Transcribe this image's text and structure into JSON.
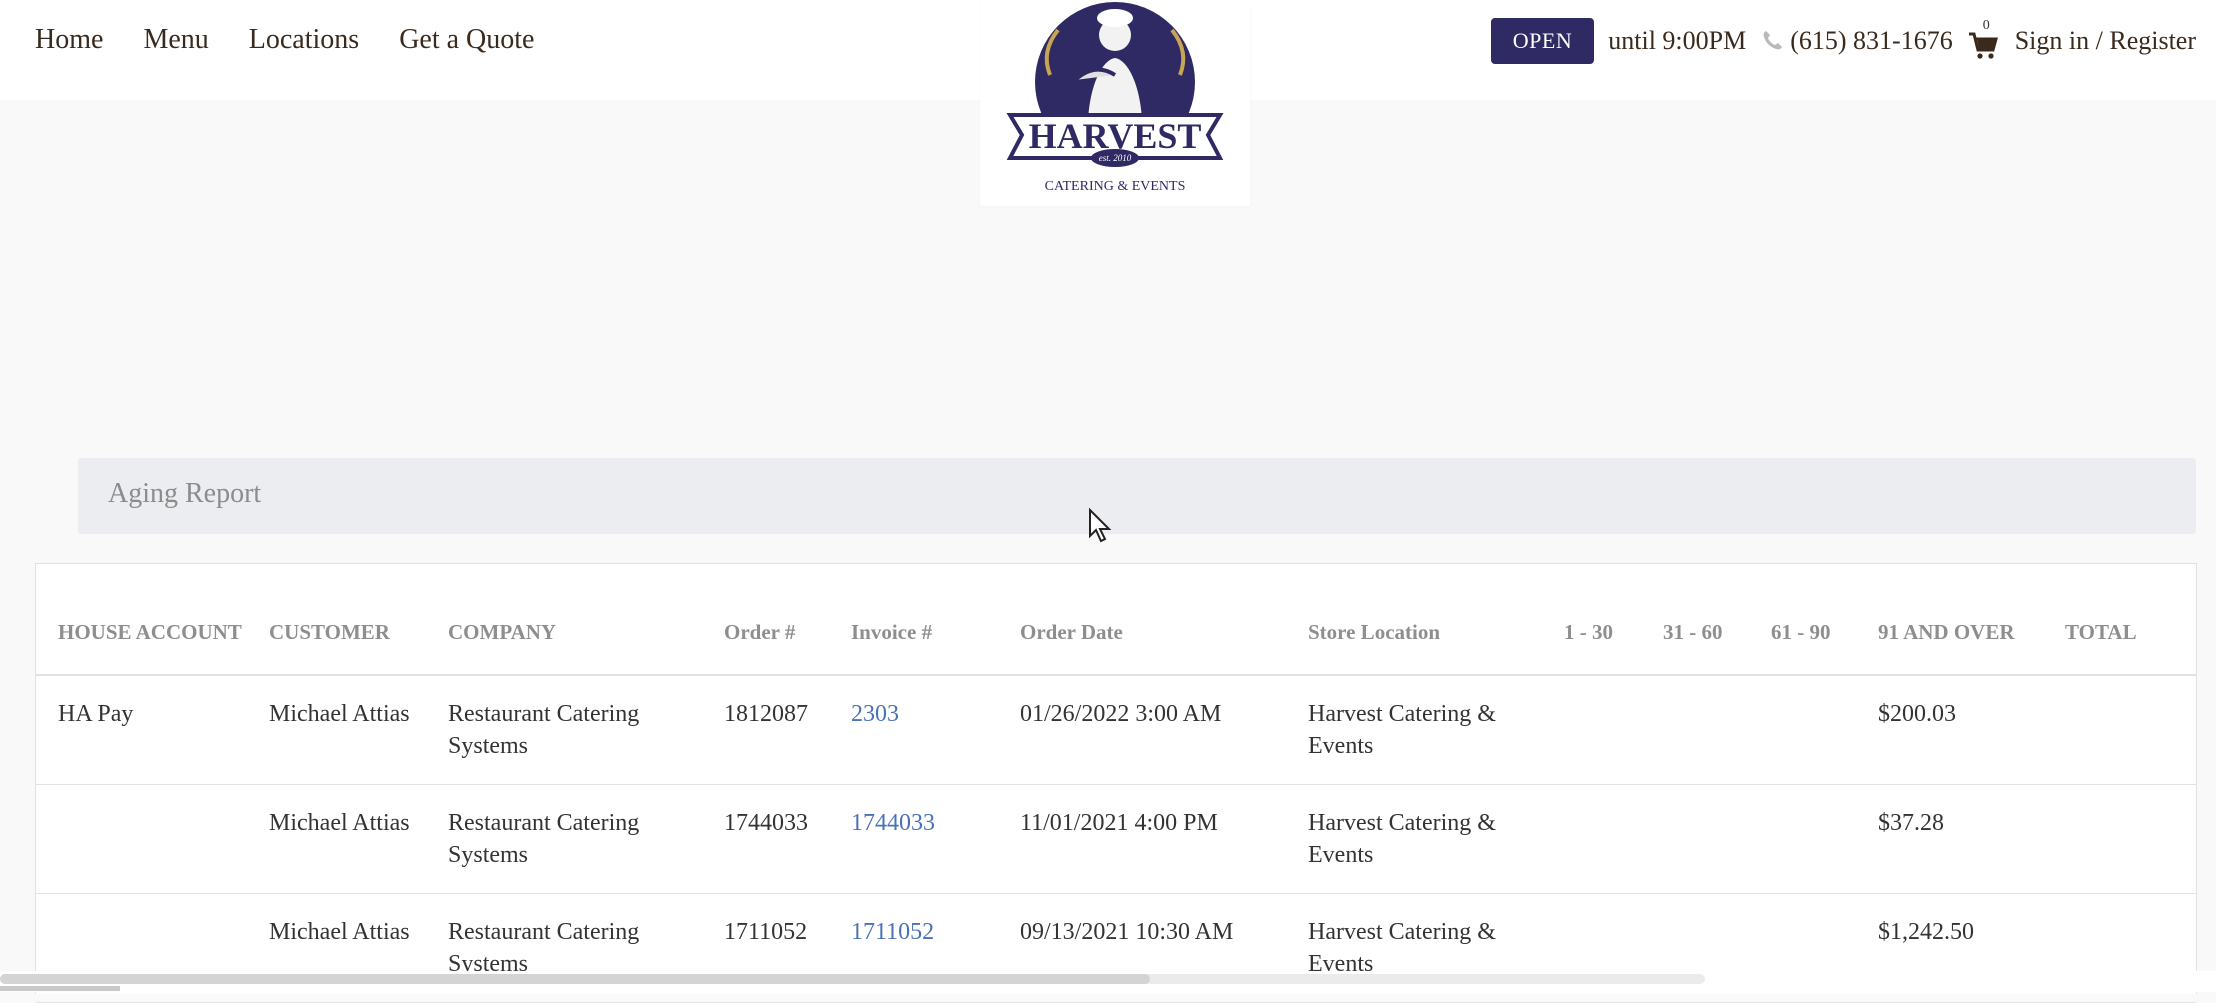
{
  "nav": {
    "items": [
      "Home",
      "Menu",
      "Locations",
      "Get a Quote"
    ]
  },
  "logo": {
    "brand": "HARVEST",
    "tagline": "CATERING & EVENTS",
    "established": "est. 2010"
  },
  "header_right": {
    "status": "OPEN",
    "hours": "until 9:00PM",
    "phone": "(615) 831-1676",
    "cart_count": "0",
    "signin": "Sign in / Register"
  },
  "report": {
    "title": "Aging Report",
    "columns": [
      "HOUSE ACCOUNT",
      "CUSTOMER",
      "COMPANY",
      "Order #",
      "Invoice #",
      "Order Date",
      "Store Location",
      "1 - 30",
      "31 - 60",
      "61 - 90",
      "91 AND OVER",
      "TOTAL"
    ],
    "rows": [
      {
        "house_account": "HA Pay",
        "customer": "Michael Attias",
        "company": "Restaurant Catering Systems",
        "order": "1812087",
        "invoice": "2303",
        "date": "01/26/2022 3:00 AM",
        "store": "Harvest Catering & Events",
        "d1_30": "",
        "d31_60": "",
        "d61_90": "",
        "d91_over": "$200.03",
        "total": ""
      },
      {
        "house_account": "",
        "customer": "Michael Attias",
        "company": "Restaurant Catering Systems",
        "order": "1744033",
        "invoice": "1744033",
        "date": "11/01/2021 4:00 PM",
        "store": "Harvest Catering & Events",
        "d1_30": "",
        "d31_60": "",
        "d61_90": "",
        "d91_over": "$37.28",
        "total": ""
      },
      {
        "house_account": "",
        "customer": "Michael Attias",
        "company": "Restaurant Catering Systems",
        "order": "1711052",
        "invoice": "1711052",
        "date": "09/13/2021 10:30 AM",
        "store": "Harvest Catering & Events",
        "d1_30": "",
        "d31_60": "",
        "d61_90": "",
        "d91_over": "$1,242.50",
        "total": ""
      }
    ]
  },
  "colors": {
    "brand_navy": "#2f2a63",
    "link_blue": "#4a72b5",
    "header_bar": "#ecedf1"
  }
}
